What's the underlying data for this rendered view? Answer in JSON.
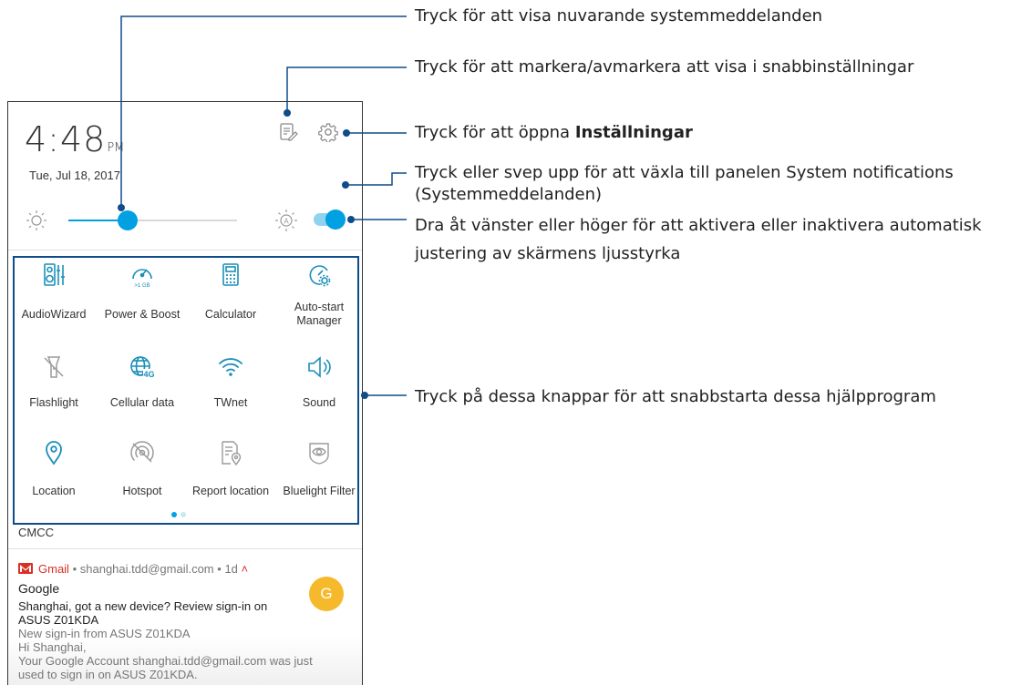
{
  "phone": {
    "time": "4:48",
    "ampm": "PM",
    "date": "Tue, Jul 18, 2017",
    "brightness_level": 0.35,
    "auto_brightness_on": true,
    "tiles": [
      {
        "label": "AudioWizard",
        "icon": "audiowizard-icon"
      },
      {
        "label": "Power & Boost",
        "icon": "power-boost-icon"
      },
      {
        "label": "Calculator",
        "icon": "calculator-icon"
      },
      {
        "label": "Auto-start\nManager",
        "icon": "auto-start-manager-icon"
      },
      {
        "label": "Flashlight",
        "icon": "flashlight-icon"
      },
      {
        "label": "Cellular data",
        "icon": "cellular-data-icon"
      },
      {
        "label": "TWnet",
        "icon": "wifi-icon"
      },
      {
        "label": "Sound",
        "icon": "sound-icon"
      },
      {
        "label": "Location",
        "icon": "location-icon"
      },
      {
        "label": "Hotspot",
        "icon": "hotspot-icon"
      },
      {
        "label": "Report location",
        "icon": "report-location-icon"
      },
      {
        "label": "Bluelight Filter",
        "icon": "bluelight-filter-icon"
      }
    ],
    "power_boost_badge": ">1 GB",
    "cellular_badge": "4G",
    "carrier": "CMCC",
    "notification": {
      "app": "Gmail",
      "account": "shanghai.tdd@gmail.com",
      "age": "1d",
      "sender": "Google",
      "avatar_letter": "G",
      "subject_1": "Shanghai, got a new device? Review sign-in on",
      "subject_2": "ASUS Z01KDA",
      "line_3": "New sign-in from ASUS Z01KDA",
      "line_4": "Hi Shanghai,",
      "line_5": "Your Google Account shanghai.tdd@gmail.com was just",
      "line_6": "used to sign in on ASUS Z01KDA."
    }
  },
  "callouts": {
    "c1": "Tryck för att visa nuvarande systemmeddelanden",
    "c2": "Tryck för att markera/avmarkera att visa i snabbinställningar",
    "c3_prefix": "Tryck för att öppna ",
    "c3_bold": "Inställningar",
    "c4_line1": "Tryck eller svep upp för att växla till panelen System notifications",
    "c4_line2": "(Systemmeddelanden)",
    "c5_line1": "Dra åt vänster eller höger för att aktivera eller inaktivera automatisk",
    "c5_line2": "justering av skärmens ljusstyrka",
    "c6": "Tryck på dessa knappar för att snabbstarta dessa hjälpprogram"
  },
  "colors": {
    "accent": "#00a0e3",
    "callout_line": "#0f4c8a",
    "gmail_red": "#d93025",
    "avatar": "#f6b92b",
    "icon_teal": "#1a8fb8",
    "icon_gray": "#9a9a9a"
  }
}
